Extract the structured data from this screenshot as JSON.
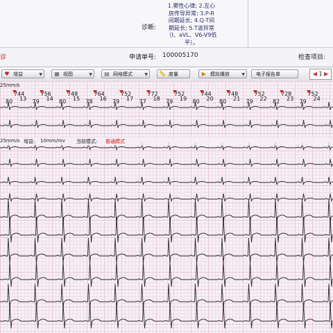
{
  "diagnosis": {
    "label": "诊断:",
    "lines": [
      "1.窦性心律; 2.左心",
      "房传导异常; 3.P-R",
      "间期延长; 4.Q-T间",
      "期延长; 5.T波异常",
      "（Ⅰ、aVL、V6-V9低",
      "平）。"
    ]
  },
  "info": {
    "left_fragment": "诊",
    "request_label": "申请单号:",
    "request_no": "100005170",
    "check_label": "检查项目:"
  },
  "toolbar": {
    "gain": "增益",
    "view": "视图",
    "grid": "网格模式",
    "measure": "度量",
    "play": "模拟播放",
    "report": "电子报告单",
    "page": "1"
  },
  "status": {
    "speed": "25mm/s",
    "gain_label": "增益:",
    "gain_value": "10mm/mv",
    "mode_label": "当前模式:",
    "mode_value": "普通模式"
  },
  "beat_numbers": [
    "13",
    "14",
    "15",
    "16",
    "17",
    "18",
    "19",
    "20",
    "21",
    "22",
    "23",
    "24"
  ],
  "rr": [
    "744",
    "756",
    "748",
    "764",
    "752",
    "772",
    "752",
    "744",
    "748",
    "752",
    "728",
    "752"
  ],
  "hr": [
    "80",
    "79",
    "80",
    "78",
    "79",
    "77",
    "79",
    "80",
    "80",
    "79",
    "82",
    "79"
  ],
  "colors": {
    "grid_major": "#e8c9d6",
    "grid_minor": "#f1dde6",
    "trace": "#2a2a2a",
    "marker": "#c22"
  }
}
